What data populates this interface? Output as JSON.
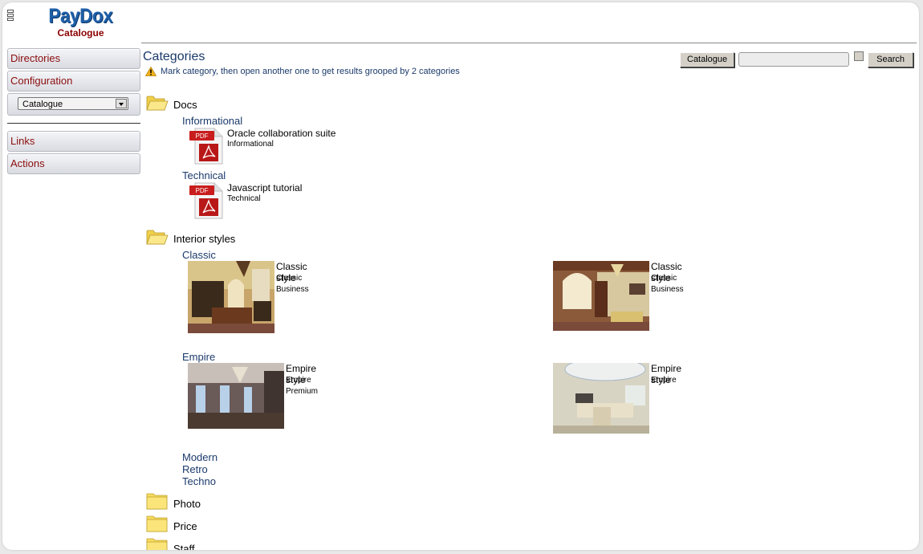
{
  "app": {
    "brand": "PayDox",
    "module": "Catalogue",
    "menu_icon": "hamburger-icon"
  },
  "sidebar": {
    "group1": [
      {
        "label": "Directories"
      },
      {
        "label": "Configuration"
      }
    ],
    "select_value": "Catalogue",
    "group2": [
      {
        "label": "Links"
      },
      {
        "label": "Actions"
      }
    ]
  },
  "main": {
    "title": "Categories",
    "hint": "Mark category, then open another one to get results grooped by 2 categories",
    "hint_icon": "warning-icon",
    "search": {
      "scope_button": "Catalogue",
      "query": "",
      "checkbox_checked": false,
      "search_button": "Search"
    }
  },
  "tree": {
    "docs": {
      "label": "Docs",
      "subcategories": [
        {
          "label": "Informational",
          "items": [
            {
              "title": "Oracle collaboration suite",
              "tag": "Informational",
              "type": "PDF"
            }
          ]
        },
        {
          "label": "Technical",
          "items": [
            {
              "title": "Javascript tutorial",
              "tag": "Technical",
              "type": "PDF"
            }
          ]
        }
      ]
    },
    "interior": {
      "label": "Interior styles",
      "classic": {
        "label": "Classic",
        "items": [
          {
            "title": "Classic style",
            "line2": "Classic",
            "line3": "Business"
          },
          {
            "title": "Classic style",
            "line2": "Classic",
            "line3": "Business"
          }
        ]
      },
      "empire": {
        "label": "Empire",
        "items": [
          {
            "title": "Empire style",
            "line2": "Empire",
            "line3": "Premium"
          },
          {
            "title": "Empire style",
            "line2": "Empire",
            "line3": ""
          }
        ]
      },
      "others": [
        "Modern",
        "Retro",
        "Techno"
      ]
    },
    "folders": [
      {
        "label": "Photo"
      },
      {
        "label": "Price"
      },
      {
        "label": "Staff"
      }
    ]
  },
  "colors": {
    "brand_blue": "#1e5fa8",
    "module_red": "#8b0000",
    "sidebar_text": "#8b0e0e",
    "link_blue": "#1b3a6b",
    "folder_yellow": "#f7dc5e"
  }
}
